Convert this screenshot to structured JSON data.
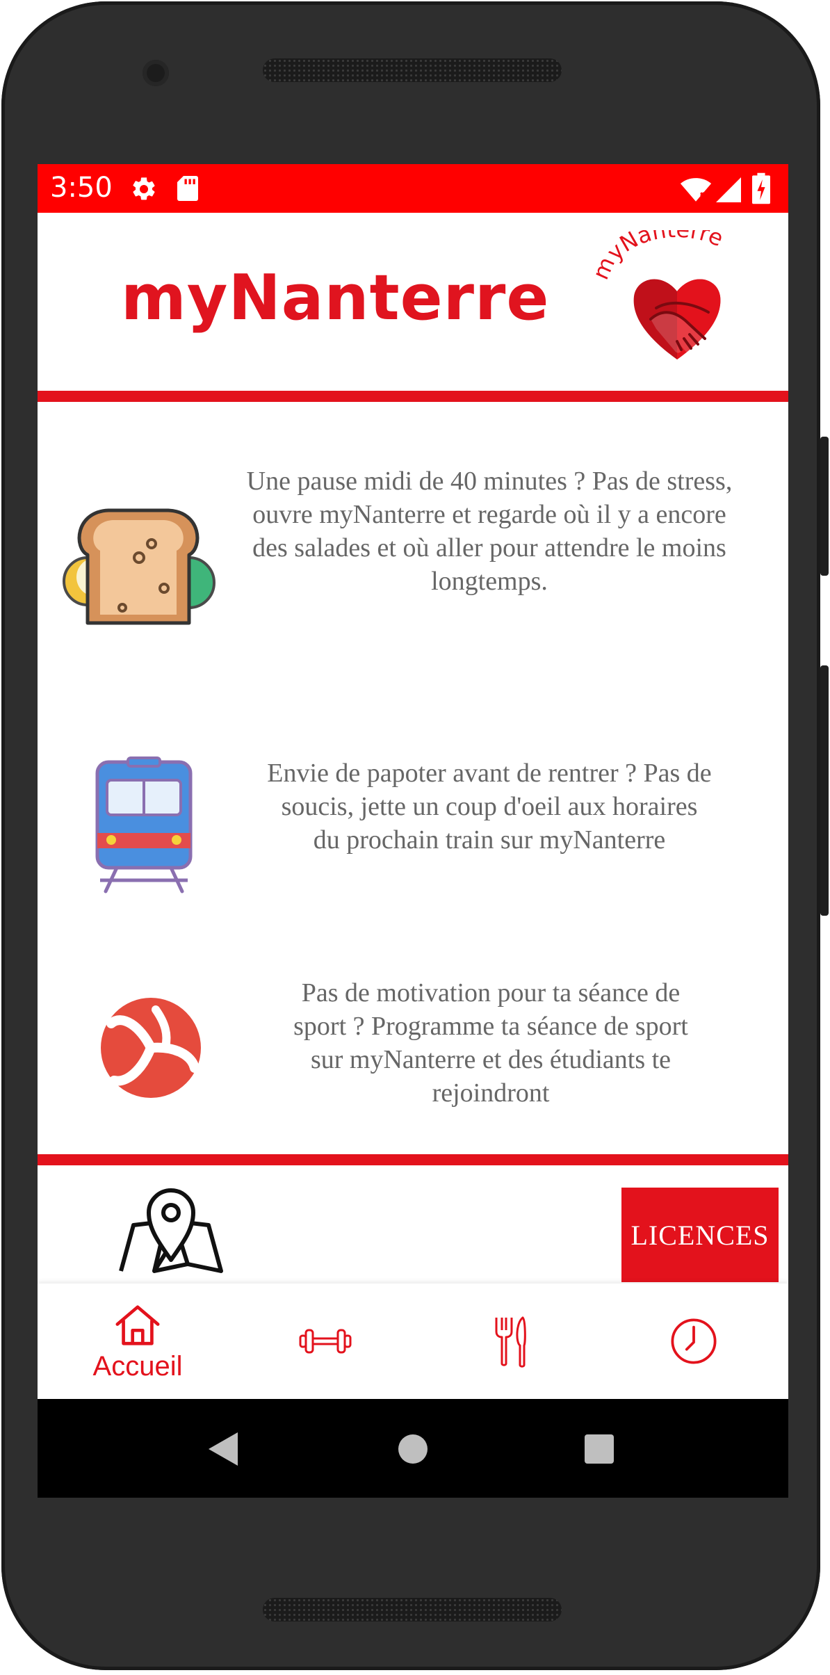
{
  "status_bar": {
    "time": "3:50",
    "icons": [
      "gear-icon",
      "sd-card-icon",
      "wifi-icon",
      "signal-icon",
      "battery-icon"
    ],
    "color": "#ff0000"
  },
  "header": {
    "title": "myNanterre",
    "logo_text": "myNanterre",
    "accent_color": "#e3121c"
  },
  "features": [
    {
      "icon": "sandwich-icon",
      "text": "Une pause midi de 40 minutes ? Pas de stress, ouvre myNanterre et regarde où il y a encore des salades et où aller pour attendre le moins longtemps."
    },
    {
      "icon": "train-icon",
      "text": "Envie de papoter avant de rentrer ? Pas de soucis, jette un coup d'oeil aux horaires du prochain train sur myNanterre"
    },
    {
      "icon": "volleyball-icon",
      "text": "Pas de motivation pour ta séance de sport ? Programme ta séance de sport sur myNanterre et des étudiants te rejoindront"
    }
  ],
  "footer": {
    "map_icon": "map-pin-icon",
    "licences_label": "LICENCES"
  },
  "bottom_nav": [
    {
      "icon": "home-icon",
      "label": "Accueil",
      "active": true
    },
    {
      "icon": "dumbbell-icon",
      "label": "",
      "active": false
    },
    {
      "icon": "fork-knife-icon",
      "label": "",
      "active": false
    },
    {
      "icon": "clock-icon",
      "label": "",
      "active": false
    }
  ],
  "system_nav": [
    "back-button",
    "home-button",
    "recents-button"
  ]
}
